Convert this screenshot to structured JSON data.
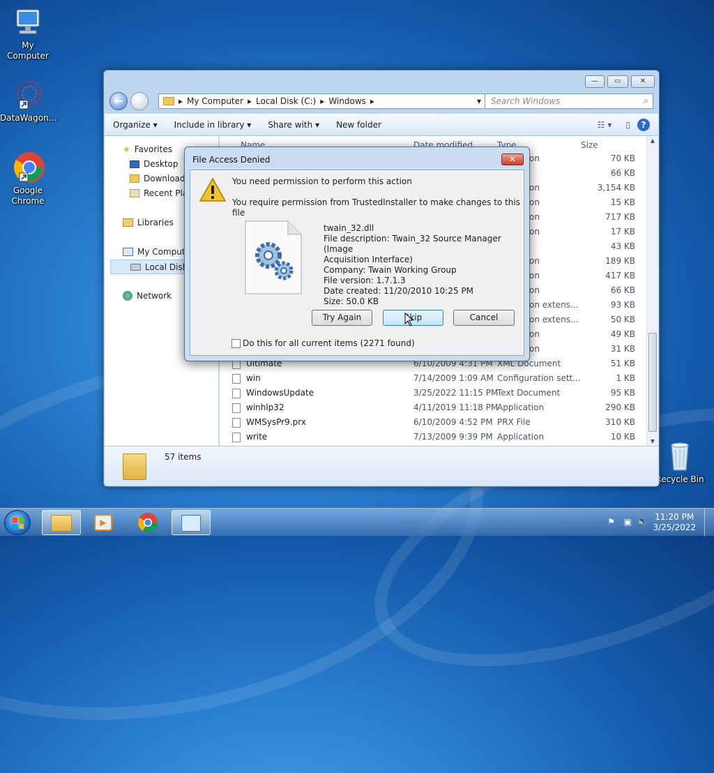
{
  "desktop": {
    "icons": [
      {
        "label": "My Computer"
      },
      {
        "label": "DataWagon..."
      },
      {
        "label": "Google Chrome"
      },
      {
        "label": "Recycle Bin"
      }
    ]
  },
  "explorer": {
    "breadcrumb": [
      "My Computer",
      "Local Disk (C:)",
      "Windows"
    ],
    "search_placeholder": "Search Windows",
    "toolbar": {
      "organize": "Organize",
      "include_library": "Include in library",
      "share_with": "Share with",
      "new_folder": "New folder"
    },
    "nav": {
      "favorites": "Favorites",
      "desktop": "Desktop",
      "downloads": "Downloads",
      "recent": "Recent Plac",
      "libraries": "Libraries",
      "my_computer": "My Compute",
      "local_disk": "Local Disk (",
      "network": "Network"
    },
    "columns": {
      "name": "Name",
      "date": "Date modified",
      "type": "Type",
      "size": "Size"
    },
    "partial_rows": [
      {
        "type": "on",
        "size": "70 KB"
      },
      {
        "type": "",
        "size": "66 KB"
      },
      {
        "type": "on",
        "size": "3,154 KB"
      },
      {
        "type": "on",
        "size": "15 KB"
      },
      {
        "type": "on",
        "size": "717 KB"
      },
      {
        "type": "on",
        "size": "17 KB"
      },
      {
        "type": "",
        "size": "43 KB"
      },
      {
        "type": "on",
        "size": "189 KB"
      },
      {
        "type": "on",
        "size": "417 KB"
      },
      {
        "type": "on",
        "size": "66 KB"
      },
      {
        "type": "on extens...",
        "size": "93 KB"
      },
      {
        "type": "on extens...",
        "size": "50 KB"
      },
      {
        "type": "on",
        "size": "49 KB"
      },
      {
        "type": "on",
        "size": "31 KB"
      }
    ],
    "files": [
      {
        "name": "Ultimate",
        "date": "6/10/2009 4:31 PM",
        "type": "XML Document",
        "size": "51 KB"
      },
      {
        "name": "win",
        "date": "7/14/2009 1:09 AM",
        "type": "Configuration sett...",
        "size": "1 KB"
      },
      {
        "name": "WindowsUpdate",
        "date": "3/25/2022 11:15 PM",
        "type": "Text Document",
        "size": "95 KB"
      },
      {
        "name": "winhlp32",
        "date": "4/11/2019 11:18 PM",
        "type": "Application",
        "size": "290 KB"
      },
      {
        "name": "WMSysPr9.prx",
        "date": "6/10/2009 4:52 PM",
        "type": "PRX File",
        "size": "310 KB"
      },
      {
        "name": "write",
        "date": "7/13/2009 9:39 PM",
        "type": "Application",
        "size": "10 KB"
      }
    ],
    "status": "57 items"
  },
  "dialog": {
    "title": "File Access Denied",
    "heading": "You need permission to perform this action",
    "subheading": "You require permission from TrustedInstaller to make changes to this file",
    "file_name": "twain_32.dll",
    "file_desc_1": "File description: Twain_32 Source Manager (Image",
    "file_desc_2": "Acquisition Interface)",
    "company": "Company: Twain Working Group",
    "version": "File version: 1.7.1.3",
    "created": "Date created: 11/20/2010 10:25 PM",
    "size": "Size: 50.0 KB",
    "try_again": "Try Again",
    "skip": "Skip",
    "cancel": "Cancel",
    "checkbox_label": "Do this for all current items (2271 found)"
  },
  "taskbar": {
    "time": "11:20 PM",
    "date": "3/25/2022"
  }
}
